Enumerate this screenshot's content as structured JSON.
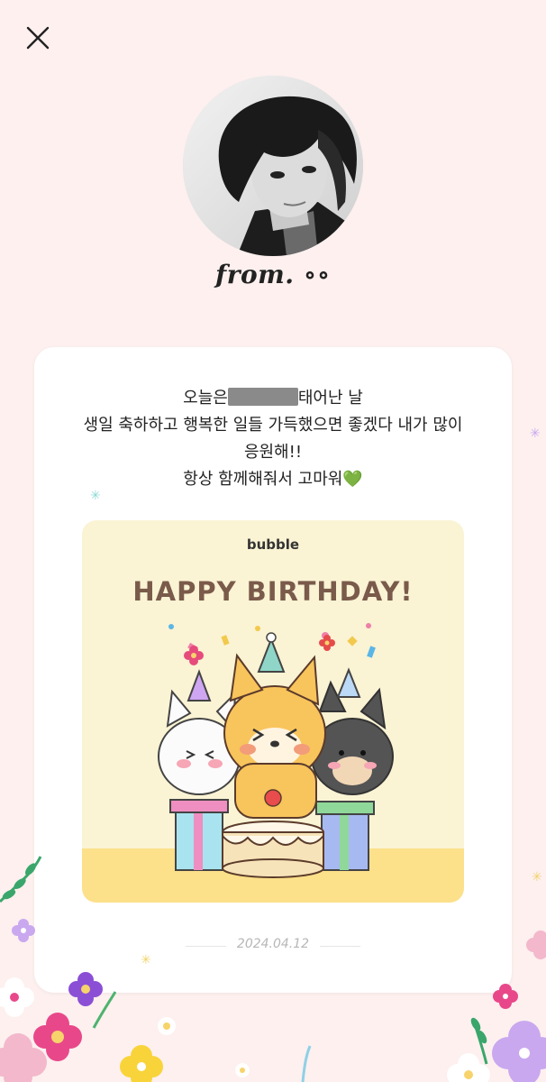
{
  "sender": {
    "from_label": "from. ∘∘"
  },
  "message": {
    "line1_before": "오늘은",
    "line1_after": "태어난 날",
    "line2": "생일 축하하고 행복한 일들 가득했으면 좋겠다 내가 많이",
    "line3": "응원해!!",
    "line4": "항상 함께해줘서 고마워",
    "emoji": "💚"
  },
  "card_image": {
    "brand": "bubble",
    "banner": "HAPPY BIRTHDAY!"
  },
  "date": "2024.04.12",
  "icons": {
    "close": "close-icon",
    "heart": "green-heart-icon"
  },
  "colors": {
    "background": "#fdf0ef",
    "card": "#ffffff",
    "image_bg": "#faf3d4",
    "banner_text": "#7a5a4a",
    "date_text": "#b7b7b7"
  }
}
